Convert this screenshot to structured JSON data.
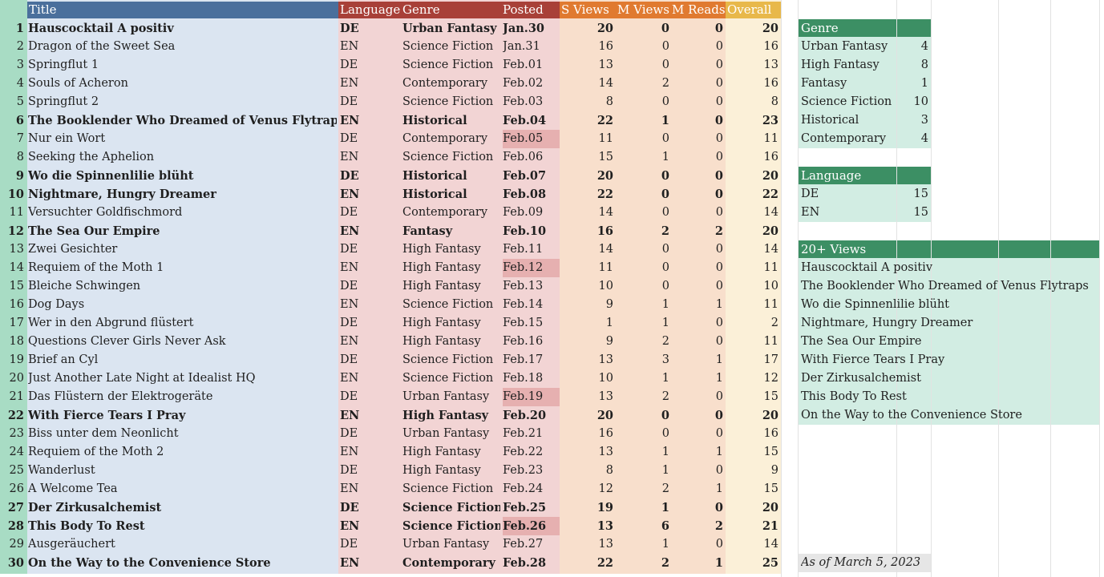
{
  "headers": {
    "title": "Title",
    "language": "Language",
    "genre": "Genre",
    "posted": "Posted",
    "s_views": "S Views",
    "m_views": "M Views",
    "m_reads": "M Reads",
    "overall": "Overall"
  },
  "rows": [
    {
      "n": "1",
      "title": "Hauscocktail A positiv",
      "lang": "DE",
      "genre": "Urban Fantasy",
      "posted": "Jan.30",
      "sv": "20",
      "mv": "0",
      "mr": "0",
      "ov": "20",
      "bold": true,
      "hl": false
    },
    {
      "n": "2",
      "title": "Dragon of the Sweet Sea",
      "lang": "EN",
      "genre": "Science Fiction",
      "posted": "Jan.31",
      "sv": "16",
      "mv": "0",
      "mr": "0",
      "ov": "16",
      "bold": false,
      "hl": false
    },
    {
      "n": "3",
      "title": "Springflut 1",
      "lang": "DE",
      "genre": "Science Fiction",
      "posted": "Feb.01",
      "sv": "13",
      "mv": "0",
      "mr": "0",
      "ov": "13",
      "bold": false,
      "hl": false
    },
    {
      "n": "4",
      "title": "Souls of Acheron",
      "lang": "EN",
      "genre": "Contemporary",
      "posted": "Feb.02",
      "sv": "14",
      "mv": "2",
      "mr": "0",
      "ov": "16",
      "bold": false,
      "hl": false
    },
    {
      "n": "5",
      "title": "Springflut 2",
      "lang": "DE",
      "genre": "Science Fiction",
      "posted": "Feb.03",
      "sv": "8",
      "mv": "0",
      "mr": "0",
      "ov": "8",
      "bold": false,
      "hl": false
    },
    {
      "n": "6",
      "title": "The Booklender Who Dreamed of Venus Flytraps",
      "lang": "EN",
      "genre": "Historical",
      "posted": "Feb.04",
      "sv": "22",
      "mv": "1",
      "mr": "0",
      "ov": "23",
      "bold": true,
      "hl": false
    },
    {
      "n": "7",
      "title": "Nur ein Wort",
      "lang": "DE",
      "genre": "Contemporary",
      "posted": "Feb.05",
      "sv": "11",
      "mv": "0",
      "mr": "0",
      "ov": "11",
      "bold": false,
      "hl": true
    },
    {
      "n": "8",
      "title": "Seeking the Aphelion",
      "lang": "EN",
      "genre": "Science Fiction",
      "posted": "Feb.06",
      "sv": "15",
      "mv": "1",
      "mr": "0",
      "ov": "16",
      "bold": false,
      "hl": false
    },
    {
      "n": "9",
      "title": "Wo die Spinnenlilie blüht",
      "lang": "DE",
      "genre": "Historical",
      "posted": "Feb.07",
      "sv": "20",
      "mv": "0",
      "mr": "0",
      "ov": "20",
      "bold": true,
      "hl": false
    },
    {
      "n": "10",
      "title": "Nightmare, Hungry Dreamer",
      "lang": "EN",
      "genre": "Historical",
      "posted": "Feb.08",
      "sv": "22",
      "mv": "0",
      "mr": "0",
      "ov": "22",
      "bold": true,
      "hl": false
    },
    {
      "n": "11",
      "title": "Versuchter Goldfischmord",
      "lang": "DE",
      "genre": "Contemporary",
      "posted": "Feb.09",
      "sv": "14",
      "mv": "0",
      "mr": "0",
      "ov": "14",
      "bold": false,
      "hl": false
    },
    {
      "n": "12",
      "title": "The Sea Our Empire",
      "lang": "EN",
      "genre": "Fantasy",
      "posted": "Feb.10",
      "sv": "16",
      "mv": "2",
      "mr": "2",
      "ov": "20",
      "bold": true,
      "hl": false
    },
    {
      "n": "13",
      "title": "Zwei Gesichter",
      "lang": "DE",
      "genre": "High Fantasy",
      "posted": "Feb.11",
      "sv": "14",
      "mv": "0",
      "mr": "0",
      "ov": "14",
      "bold": false,
      "hl": false
    },
    {
      "n": "14",
      "title": "Requiem of the Moth 1",
      "lang": "EN",
      "genre": "High Fantasy",
      "posted": "Feb.12",
      "sv": "11",
      "mv": "0",
      "mr": "0",
      "ov": "11",
      "bold": false,
      "hl": true
    },
    {
      "n": "15",
      "title": "Bleiche Schwingen",
      "lang": "DE",
      "genre": "High Fantasy",
      "posted": "Feb.13",
      "sv": "10",
      "mv": "0",
      "mr": "0",
      "ov": "10",
      "bold": false,
      "hl": false
    },
    {
      "n": "16",
      "title": "Dog Days",
      "lang": "EN",
      "genre": "Science Fiction",
      "posted": "Feb.14",
      "sv": "9",
      "mv": "1",
      "mr": "1",
      "ov": "11",
      "bold": false,
      "hl": false
    },
    {
      "n": "17",
      "title": "Wer in den Abgrund flüstert",
      "lang": "DE",
      "genre": "High Fantasy",
      "posted": "Feb.15",
      "sv": "1",
      "mv": "1",
      "mr": "0",
      "ov": "2",
      "bold": false,
      "hl": false
    },
    {
      "n": "18",
      "title": "Questions Clever Girls Never Ask",
      "lang": "EN",
      "genre": "High Fantasy",
      "posted": "Feb.16",
      "sv": "9",
      "mv": "2",
      "mr": "0",
      "ov": "11",
      "bold": false,
      "hl": false
    },
    {
      "n": "19",
      "title": "Brief an Cyl",
      "lang": "DE",
      "genre": "Science Fiction",
      "posted": "Feb.17",
      "sv": "13",
      "mv": "3",
      "mr": "1",
      "ov": "17",
      "bold": false,
      "hl": false
    },
    {
      "n": "20",
      "title": "Just Another Late Night at Idealist HQ",
      "lang": "EN",
      "genre": "Science Fiction",
      "posted": "Feb.18",
      "sv": "10",
      "mv": "1",
      "mr": "1",
      "ov": "12",
      "bold": false,
      "hl": false
    },
    {
      "n": "21",
      "title": "Das Flüstern der Elektrogeräte",
      "lang": "DE",
      "genre": "Urban Fantasy",
      "posted": "Feb.19",
      "sv": "13",
      "mv": "2",
      "mr": "0",
      "ov": "15",
      "bold": false,
      "hl": true
    },
    {
      "n": "22",
      "title": "With Fierce Tears I Pray",
      "lang": "EN",
      "genre": "High Fantasy",
      "posted": "Feb.20",
      "sv": "20",
      "mv": "0",
      "mr": "0",
      "ov": "20",
      "bold": true,
      "hl": false
    },
    {
      "n": "23",
      "title": "Biss unter dem Neonlicht",
      "lang": "DE",
      "genre": "Urban Fantasy",
      "posted": "Feb.21",
      "sv": "16",
      "mv": "0",
      "mr": "0",
      "ov": "16",
      "bold": false,
      "hl": false
    },
    {
      "n": "24",
      "title": "Requiem of the Moth 2",
      "lang": "EN",
      "genre": "High Fantasy",
      "posted": "Feb.22",
      "sv": "13",
      "mv": "1",
      "mr": "1",
      "ov": "15",
      "bold": false,
      "hl": false
    },
    {
      "n": "25",
      "title": "Wanderlust",
      "lang": "DE",
      "genre": "High Fantasy",
      "posted": "Feb.23",
      "sv": "8",
      "mv": "1",
      "mr": "0",
      "ov": "9",
      "bold": false,
      "hl": false
    },
    {
      "n": "26",
      "title": "A Welcome Tea",
      "lang": "EN",
      "genre": "Science Fiction",
      "posted": "Feb.24",
      "sv": "12",
      "mv": "2",
      "mr": "1",
      "ov": "15",
      "bold": false,
      "hl": false
    },
    {
      "n": "27",
      "title": "Der Zirkusalchemist",
      "lang": "DE",
      "genre": "Science Fiction",
      "posted": "Feb.25",
      "sv": "19",
      "mv": "1",
      "mr": "0",
      "ov": "20",
      "bold": true,
      "hl": false
    },
    {
      "n": "28",
      "title": "This Body To Rest",
      "lang": "EN",
      "genre": "Science Fiction",
      "posted": "Feb.26",
      "sv": "13",
      "mv": "6",
      "mr": "2",
      "ov": "21",
      "bold": true,
      "hl": true
    },
    {
      "n": "29",
      "title": "Ausgeräuchert",
      "lang": "DE",
      "genre": "Urban Fantasy",
      "posted": "Feb.27",
      "sv": "13",
      "mv": "1",
      "mr": "0",
      "ov": "14",
      "bold": false,
      "hl": false
    },
    {
      "n": "30",
      "title": "On the Way to the Convenience Store",
      "lang": "EN",
      "genre": "Contemporary",
      "posted": "Feb.28",
      "sv": "22",
      "mv": "2",
      "mr": "1",
      "ov": "25",
      "bold": true,
      "hl": false
    }
  ],
  "genre_summary": {
    "header": "Genre",
    "items": [
      {
        "label": "Urban Fantasy",
        "count": "4"
      },
      {
        "label": "High Fantasy",
        "count": "8"
      },
      {
        "label": "Fantasy",
        "count": "1"
      },
      {
        "label": "Science Fiction",
        "count": "10"
      },
      {
        "label": "Historical",
        "count": "3"
      },
      {
        "label": "Contemporary",
        "count": "4"
      }
    ]
  },
  "language_summary": {
    "header": "Language",
    "items": [
      {
        "label": "DE",
        "count": "15"
      },
      {
        "label": "EN",
        "count": "15"
      }
    ]
  },
  "views_summary": {
    "header": "20+ Views",
    "items": [
      "Hauscocktail A positiv",
      "The Booklender Who Dreamed of Venus Flytraps",
      "Wo die Spinnenlilie blüht",
      "Nightmare, Hungry Dreamer",
      "The Sea Our Empire",
      "With Fierce Tears I Pray",
      "Der Zirkusalchemist",
      "This Body To Rest",
      "On the Way to the Convenience Store"
    ]
  },
  "as_of": "As of March 5, 2023",
  "colors": {
    "rownum_bg": "#a8dcc4",
    "title_bg": "#dbe5f1",
    "title_hdr": "#4a6f9c",
    "langgenre_bg": "#f2d4d4",
    "langgenre_hdr": "#a84038",
    "views_bg": "#f8dfcc",
    "views_hdr": "#e07a30",
    "overall_bg": "#fbf0d8",
    "overall_hdr": "#e8b84a",
    "summary_bg": "#d2ede3",
    "summary_hdr": "#3c8f64",
    "highlight": "#e6b0b0",
    "as_of_bg": "#e6e6e6"
  }
}
